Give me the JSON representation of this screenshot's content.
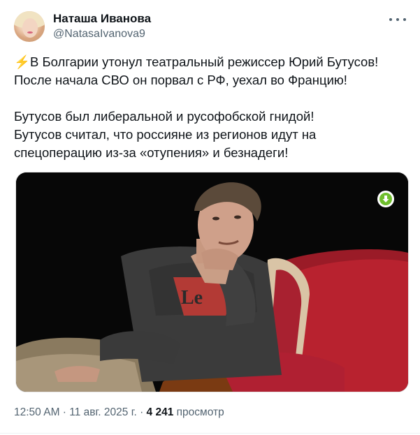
{
  "author": {
    "name": "Наташа Иванова",
    "handle": "@NatasaIvanova9"
  },
  "tweet": {
    "emoji": "⚡",
    "lines": [
      "В Болгарии утонул театральный режиссер Юрий Бутусов!",
      "После начала СВО он порвал с РФ, уехал во Францию!",
      "Бутусов  был либеральной и русофобской гнидой!",
      "Бутусов считал, что россияне из регионов идут на",
      "спецоперацию из-за «отупения» и безнадеги!"
    ]
  },
  "photo": {
    "shirt_logo_text": "Le"
  },
  "meta": {
    "time": "12:50 AM",
    "sep1": " · ",
    "date": "11 авг. 2025 г.",
    "sep2": " · ",
    "views_count": "4 241",
    "views_label": "просмотр"
  },
  "colors": {
    "text": "#0f1419",
    "secondary": "#536471",
    "download_badge": "#6fbe2d",
    "armchair": "#b8222f"
  },
  "icons": {
    "more": "more-icon",
    "download": "download-icon"
  }
}
